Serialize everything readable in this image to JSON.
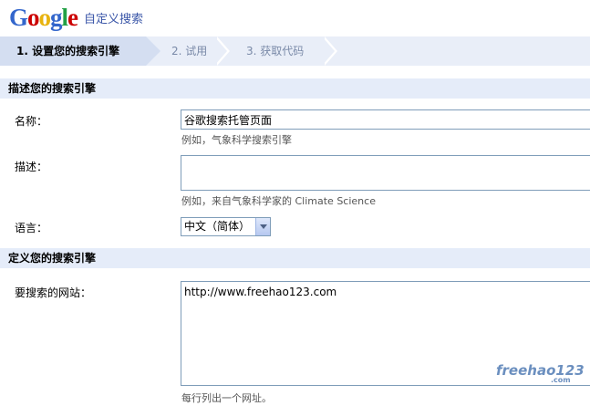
{
  "header": {
    "logo_letters": [
      {
        "char": "G",
        "color": "#3366cc"
      },
      {
        "char": "o",
        "color": "#cc0000"
      },
      {
        "char": "o",
        "color": "#e8b30e"
      },
      {
        "char": "g",
        "color": "#3366cc"
      },
      {
        "char": "l",
        "color": "#22a045"
      },
      {
        "char": "e",
        "color": "#cc0000"
      }
    ],
    "product_title": "自定义搜索"
  },
  "steps": [
    {
      "label": "1. 设置您的搜索引擎",
      "active": true
    },
    {
      "label": "2. 试用",
      "active": false
    },
    {
      "label": "3. 获取代码",
      "active": false
    }
  ],
  "section_describe": {
    "title": "描述您的搜索引擎",
    "name_label": "名称：",
    "name_value": "谷歌搜索托管页面",
    "name_hint": "例如，气象科学搜索引擎",
    "desc_label": "描述：",
    "desc_value": "",
    "desc_hint": "例如，来自气象科学家的 Climate Science",
    "lang_label": "语言：",
    "lang_selected": "中文（简体）"
  },
  "section_define": {
    "title": "定义您的搜索引擎",
    "sites_label": "要搜索的网站：",
    "sites_value": "http://www.freehao123.com",
    "sites_hint": "每行列出一个网址。"
  },
  "watermark": {
    "text": "freehao123",
    "suffix": ".com"
  }
}
